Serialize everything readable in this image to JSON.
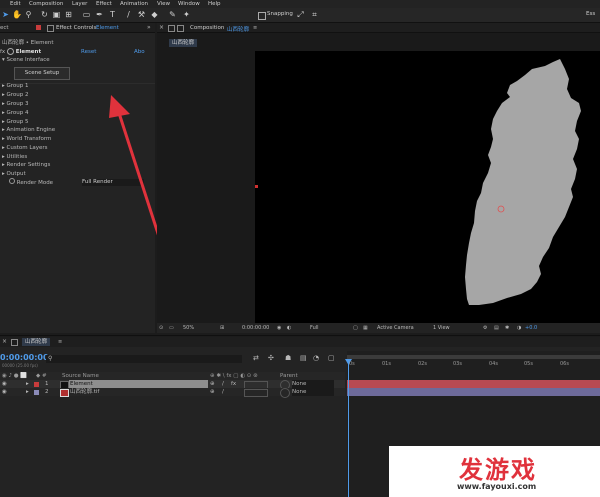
{
  "menu": [
    "Edit",
    "Composition",
    "Layer",
    "Effect",
    "Animation",
    "View",
    "Window",
    "Help"
  ],
  "toolbar": {
    "snapping_label": "Snapping",
    "right_label": "Ess"
  },
  "effect_controls": {
    "tab_left": "ect",
    "tab_title": "Effect Controls",
    "tab_layer": "Element",
    "breadcrumb": "山西轮廓 • Element",
    "effect_name": "Element",
    "reset_label": "Reset",
    "about_label": "Abo",
    "scene_interface": "Scene Interface",
    "scene_setup_label": "Scene Setup",
    "groups": [
      "Group 1",
      "Group 2",
      "Group 3",
      "Group 4",
      "Group 5",
      "Animation Engine",
      "World Transform",
      "Custom Layers",
      "Utilities",
      "Render Settings",
      "Output"
    ],
    "render_mode_label": "Render Mode",
    "render_mode_value": "Full Render"
  },
  "composition": {
    "tab_title": "Composition",
    "tab_name": "山西轮廓",
    "sub_tab": "山西轮廓",
    "footer": {
      "zoom": "50%",
      "timecode": "0:00:00:00",
      "resolution": "Full",
      "camera": "Active Camera",
      "views": "1 View",
      "exposure": "+0.0"
    }
  },
  "timeline": {
    "tab_name": "山西轮廓",
    "timecode": "0:00:00:00",
    "subcode": "00000 (25.00 fps)",
    "search_placeholder": "",
    "columns": {
      "source_name": "Source Name",
      "parent": "Parent"
    },
    "layers": [
      {
        "num": "1",
        "name": "Element",
        "parent": "None",
        "label_color": "#c83c3c"
      },
      {
        "num": "2",
        "name": "山西轮廓.tif",
        "parent": "None",
        "label_color": "#8a8ab8"
      }
    ],
    "ruler_ticks": [
      "0s",
      "01s",
      "02s",
      "03s",
      "04s",
      "05s",
      "06s"
    ]
  },
  "watermark": {
    "brand": "发游戏",
    "url": "www.fayouxi.com"
  },
  "colors": {
    "accent": "#4f9bea",
    "arrow": "#e0323c",
    "shape": "#a6a6a6",
    "bar_red": "#b84a52",
    "bar_purple": "#6d6a9a"
  }
}
